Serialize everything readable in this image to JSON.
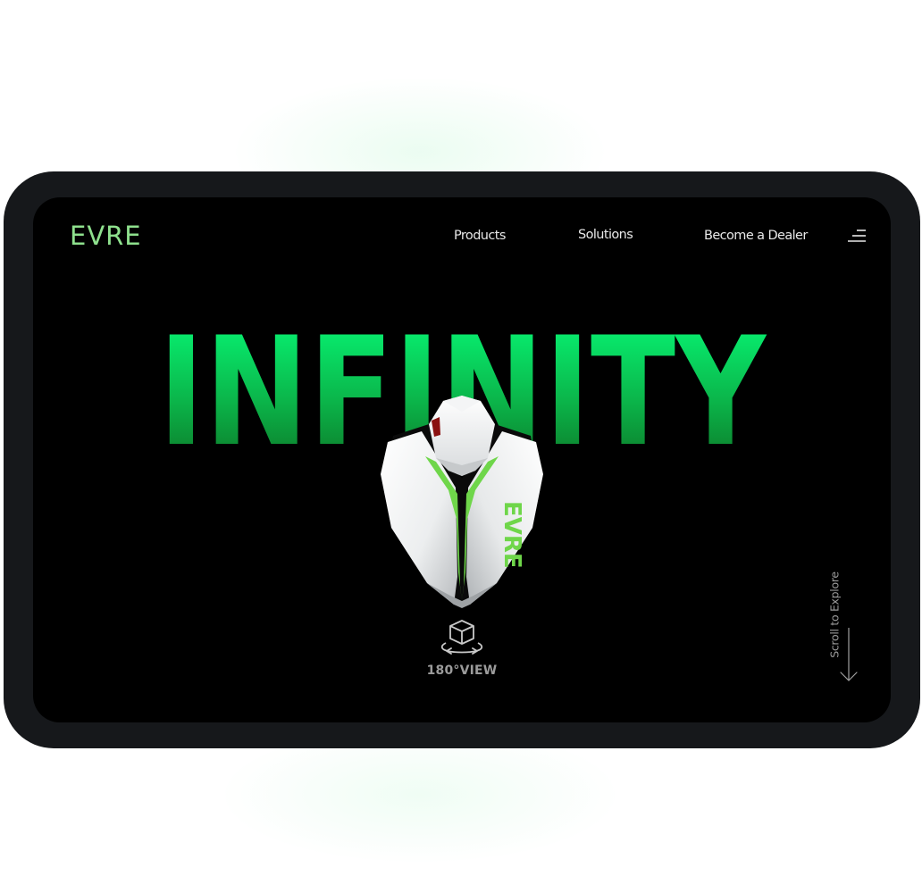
{
  "brand": {
    "logo_text": "EVRE"
  },
  "nav": {
    "links": [
      {
        "label": "Products"
      },
      {
        "label": "Solutions"
      },
      {
        "label": "Become a Dealer"
      }
    ],
    "menu_icon": "menu-icon"
  },
  "hero": {
    "headline": "INFINITY",
    "product_brand_mark": "EVRE",
    "view_label": "180°VIEW",
    "view_icon": "3d-rotate-cube-icon"
  },
  "scroll": {
    "label": "Scroll to Explore",
    "icon": "arrow-down-icon"
  },
  "colors": {
    "frame": "#16181b",
    "screen": "#000000",
    "brand_green": "#8ee08d",
    "headline_green_top": "#06ff7a",
    "headline_green_bottom": "#0c7a24",
    "text_light": "#e8e8e8",
    "text_muted": "#9a9a9a"
  }
}
